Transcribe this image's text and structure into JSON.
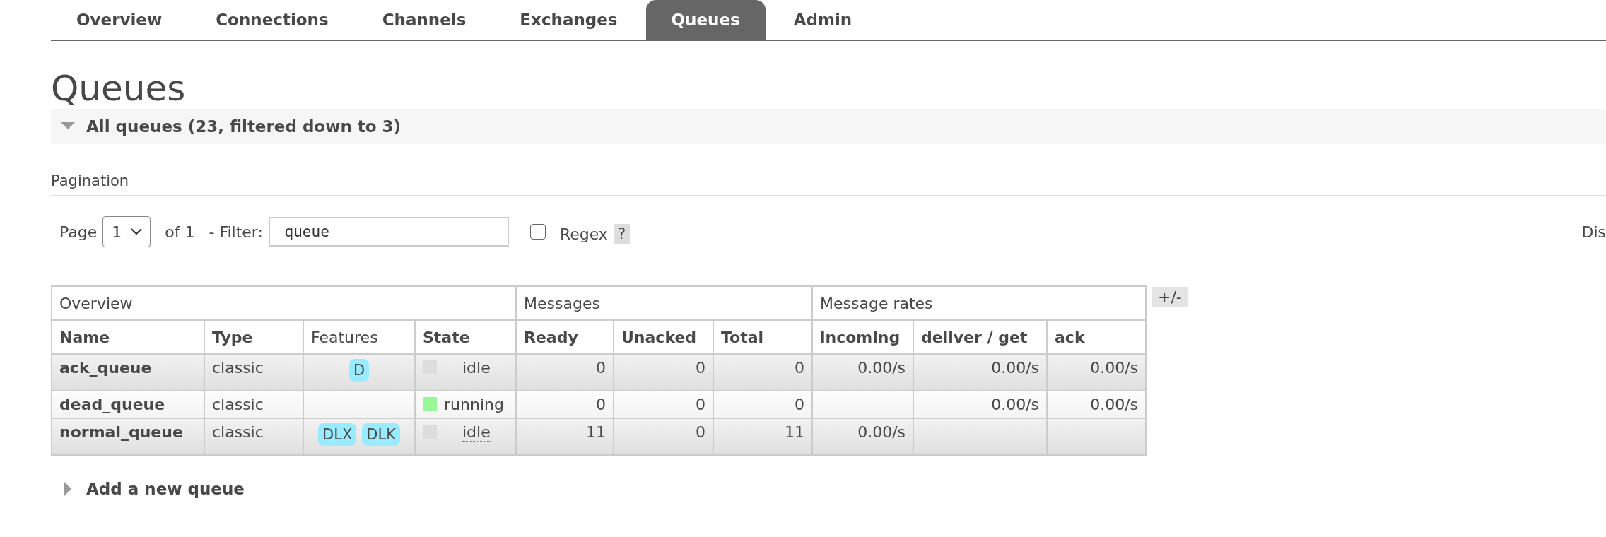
{
  "tabs": [
    {
      "label": "Overview",
      "selected": false
    },
    {
      "label": "Connections",
      "selected": false
    },
    {
      "label": "Channels",
      "selected": false
    },
    {
      "label": "Exchanges",
      "selected": false
    },
    {
      "label": "Queues",
      "selected": true
    },
    {
      "label": "Admin",
      "selected": false
    }
  ],
  "page_title": "Queues",
  "all_queues": {
    "title": "All queues (23, filtered down to 3)",
    "expanded": true
  },
  "pagination": {
    "title": "Pagination",
    "page_label": "Page",
    "page_value": "1",
    "of_label": "of 1",
    "filter_label": "- Filter:",
    "filter_value": "_queue",
    "regex": {
      "label": "Regex",
      "checked": false
    },
    "help": "?",
    "right_text": "Dis"
  },
  "table": {
    "groups": [
      {
        "label": "Overview"
      },
      {
        "label": "Messages"
      },
      {
        "label": "Message rates"
      }
    ],
    "columns": [
      {
        "label": "Name",
        "sortable": true
      },
      {
        "label": "Type",
        "sortable": true
      },
      {
        "label": "Features",
        "sortable": false
      },
      {
        "label": "State",
        "sortable": true
      },
      {
        "label": "Ready",
        "sortable": true
      },
      {
        "label": "Unacked",
        "sortable": true
      },
      {
        "label": "Total",
        "sortable": true
      },
      {
        "label": "incoming",
        "sortable": true
      },
      {
        "label": "deliver / get",
        "sortable": true
      },
      {
        "label": "ack",
        "sortable": true
      }
    ],
    "rows": [
      {
        "name": "ack_queue",
        "type": "classic",
        "features": [
          "D"
        ],
        "state": {
          "label": "idle",
          "color": "#dddddd",
          "kind": "idle"
        },
        "ready": "0",
        "unacked": "0",
        "total": "0",
        "incoming": "0.00/s",
        "deliver_get": "0.00/s",
        "ack": "0.00/s"
      },
      {
        "name": "dead_queue",
        "type": "classic",
        "features": [],
        "state": {
          "label": "running",
          "color": "#98f898",
          "kind": "running"
        },
        "ready": "0",
        "unacked": "0",
        "total": "0",
        "deliver_get": "0.00/s",
        "ack": "0.00/s"
      },
      {
        "name": "normal_queue",
        "type": "classic",
        "features": [
          "DLX",
          "DLK"
        ],
        "state": {
          "label": "idle",
          "color": "#dddddd",
          "kind": "idle"
        },
        "ready": "11",
        "unacked": "0",
        "total": "11",
        "incoming": "0.00/s"
      }
    ],
    "toggle": "+/-"
  },
  "add_queue": {
    "title": "Add a new queue",
    "expanded": false
  }
}
